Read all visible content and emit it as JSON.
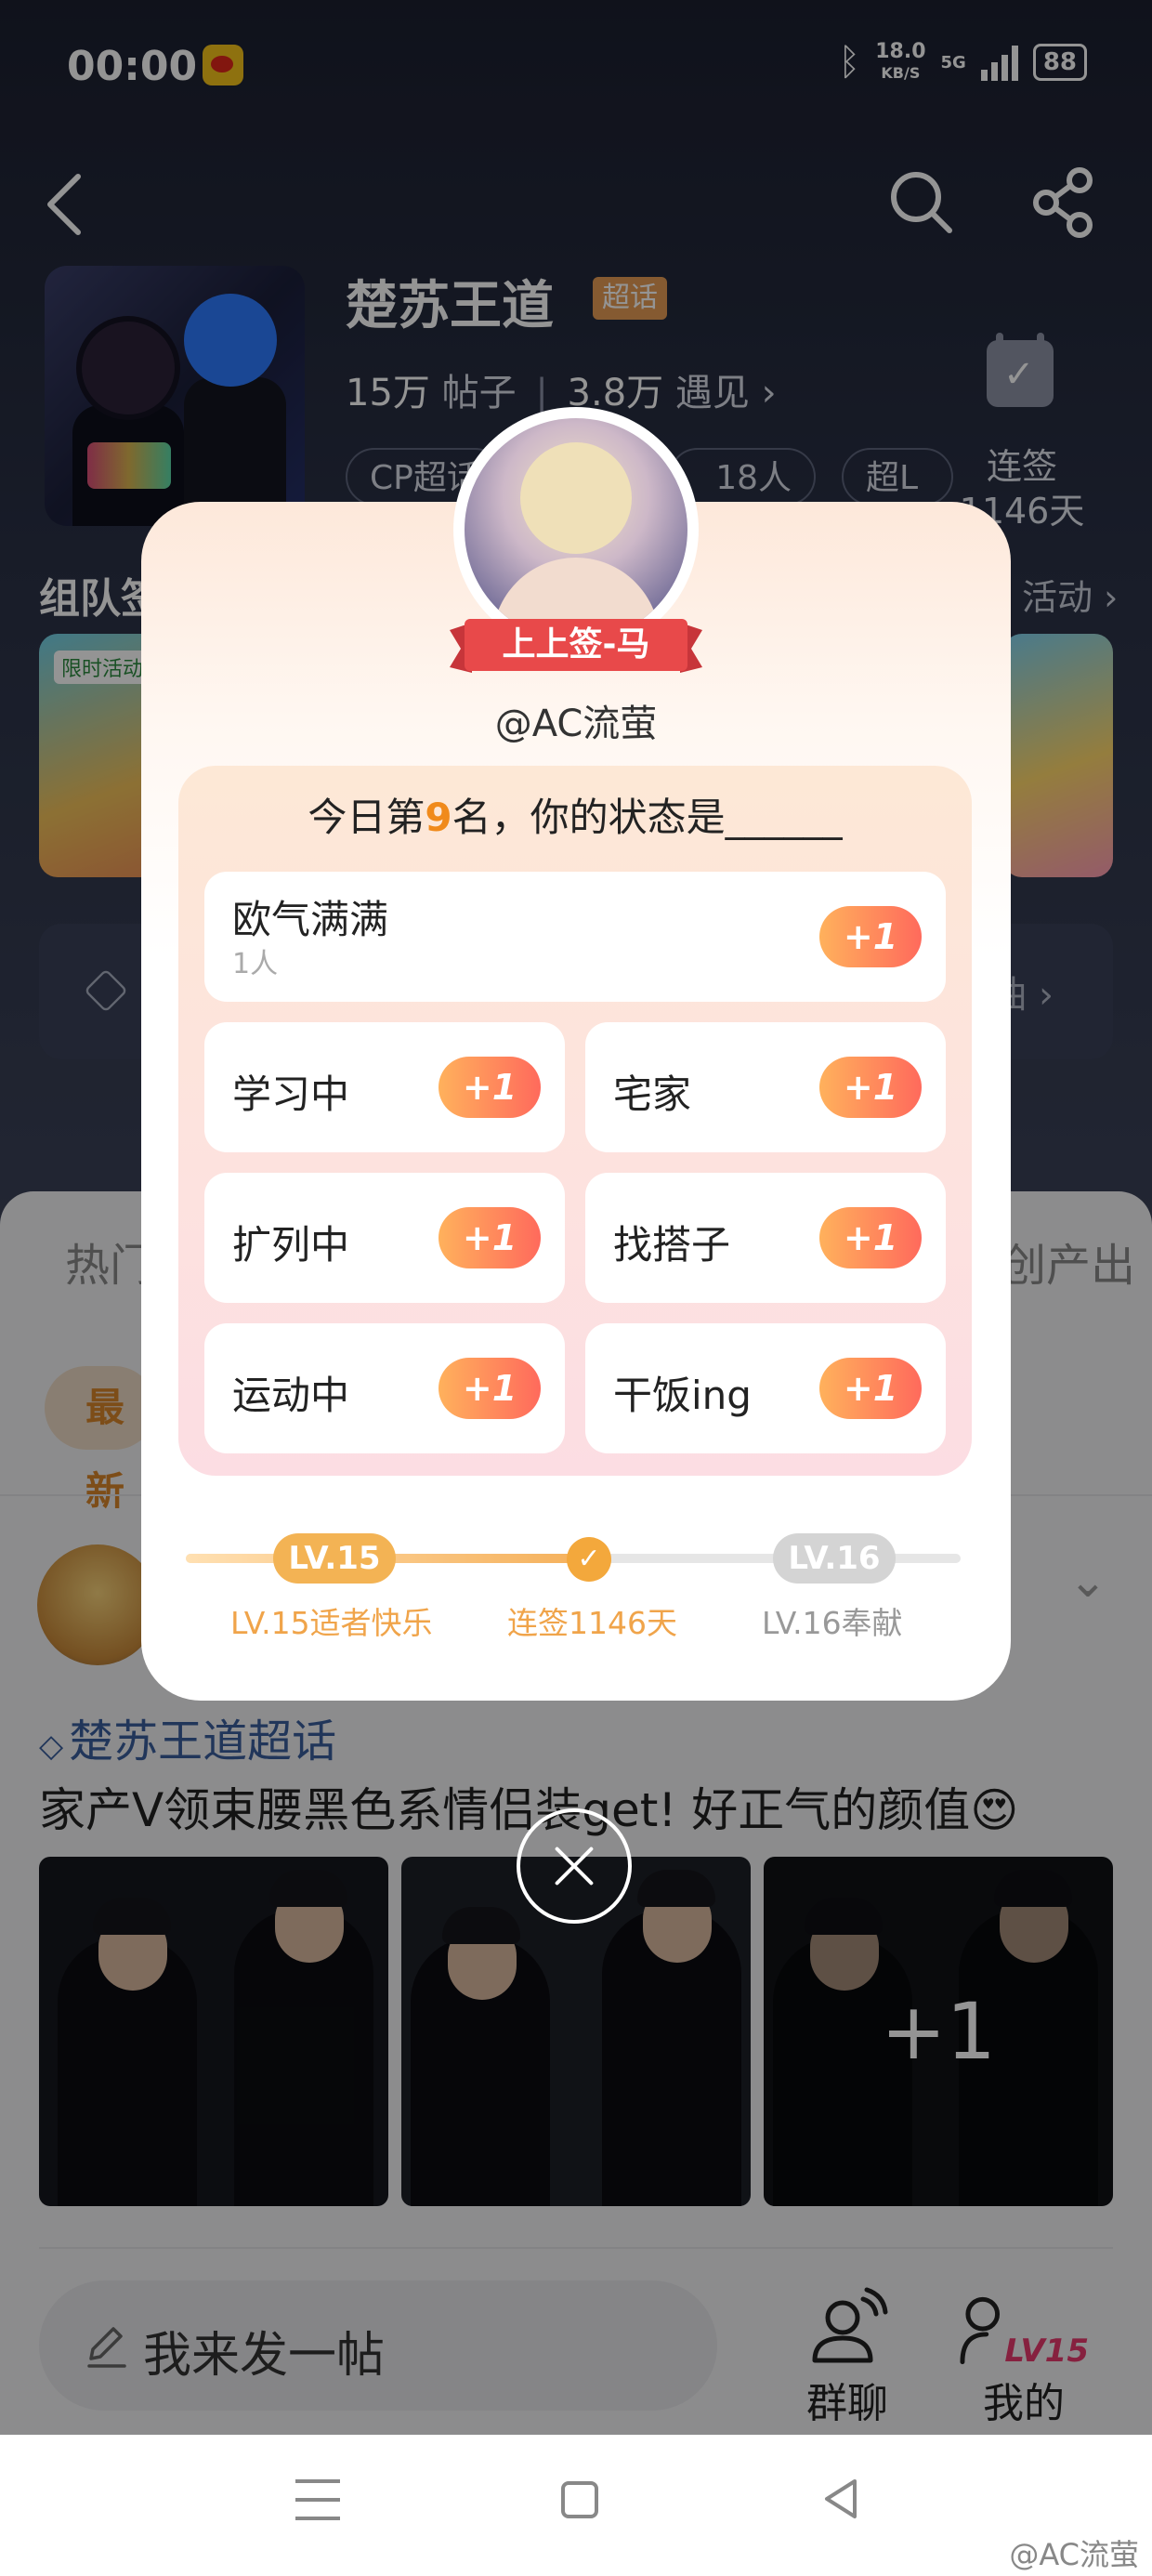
{
  "status_bar": {
    "time": "00:00",
    "speed_value": "18.0",
    "speed_unit": "KB/S",
    "network": "5G",
    "battery": "88"
  },
  "topic": {
    "title": "楚苏王道",
    "badge": "超话",
    "posts_count": "15万",
    "posts_label": "帖子",
    "meet_count": "3.8万",
    "meet_label": "遇见",
    "chips": [
      "CP超话",
      "18人",
      "超L"
    ],
    "checkin_label": "连签",
    "checkin_days": "1146天"
  },
  "sections": {
    "team_title": "组队签",
    "team_more": "活动",
    "limited_tag": "限时活动",
    "edit_right": "油"
  },
  "tabs": {
    "left": "热门",
    "right": "原创产出",
    "newest": "最新"
  },
  "post": {
    "topic": "楚苏王道超话",
    "text": "家产V领束腰黑色系情侣装get! 好正气的颜值😍",
    "more_images": "+1"
  },
  "bottom_bar": {
    "compose": "我来发一帖",
    "group_chat": "群聊",
    "mine": "我的",
    "mine_level": "LV15"
  },
  "modal": {
    "ribbon": "上上签-马",
    "handle": "@AC流萤",
    "question_prefix": "今日第",
    "rank": "9",
    "question_suffix": "名，你的状态是______",
    "options": [
      {
        "label": "欧气满满",
        "count": "1人",
        "action": "+1"
      },
      {
        "label": "学习中",
        "action": "+1"
      },
      {
        "label": "宅家",
        "action": "+1"
      },
      {
        "label": "扩列中",
        "action": "+1"
      },
      {
        "label": "找搭子",
        "action": "+1"
      },
      {
        "label": "运动中",
        "action": "+1"
      },
      {
        "label": "干饭ing",
        "action": "+1"
      }
    ],
    "level_current": "LV.15",
    "level_next": "LV.16",
    "level_current_caption": "LV.15适者快乐",
    "streak_caption": "连签1146天",
    "level_next_caption": "LV.16奉献",
    "progress_fraction": 0.52
  },
  "watermark": "@AC流萤",
  "colors": {
    "accent_orange": "#f08a1b",
    "level_gold": "#f3b354",
    "ribbon_red": "#e8494a",
    "topic_blue": "#3a5d9c"
  }
}
